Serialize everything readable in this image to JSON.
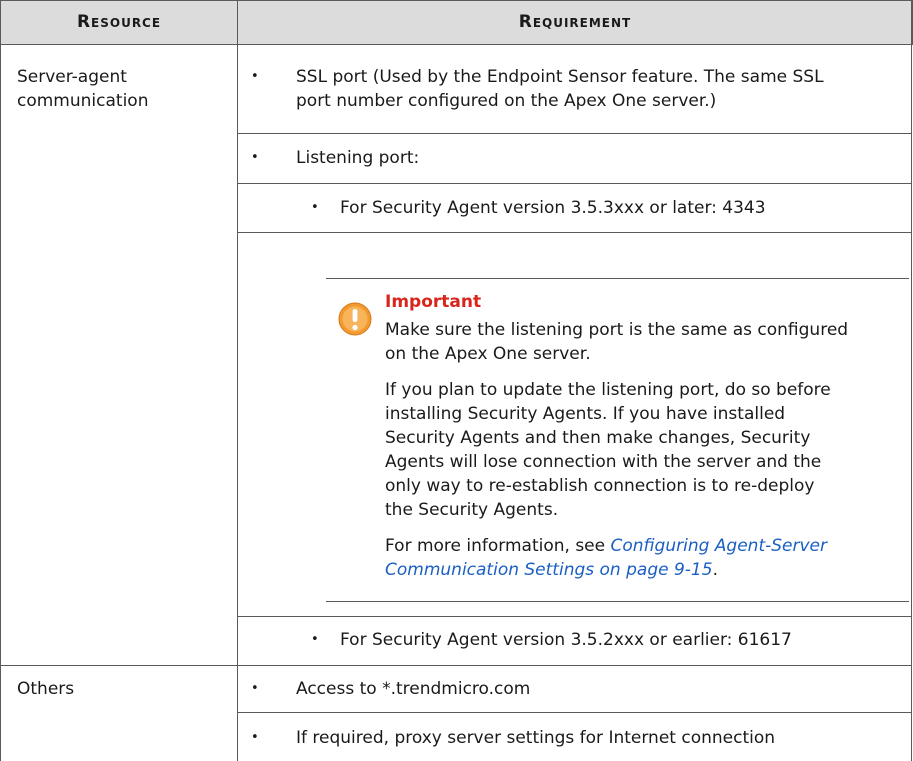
{
  "table": {
    "headers": {
      "resource": "Resource",
      "requirement": "Requirement"
    },
    "rows": [
      {
        "resource_line1": "Server-agent",
        "resource_line2": "communication",
        "items": {
          "ssl_line1": "SSL port (Used by the Endpoint Sensor feature. The same SSL",
          "ssl_line2": "port number configured on the Apex One server.)",
          "listening": "Listening port:",
          "sub_353": "For Security Agent version 3.5.3xxx or later: 4343",
          "sub_352": "For Security Agent version 3.5.2xxx or earlier: 61617"
        },
        "note": {
          "title": "Important",
          "p1_line1": "Make sure the listening port is the same as configured",
          "p1_line2": "on the Apex One server.",
          "p2_line1": "If you plan to update the listening port, do so before",
          "p2_line2": "installing Security Agents. If you have installed",
          "p2_line3": "Security Agents and then make changes, Security",
          "p2_line4": "Agents will lose connection with the server and the",
          "p2_line5": "only way to re-establish connection is to re-deploy",
          "p2_line6": "the Security Agents.",
          "p3_prefix": "For more information, see ",
          "p3_link_line1": "Configuring Agent-Server",
          "p3_link_line2": "Communication Settings on page 9-15",
          "p3_suffix": "."
        }
      },
      {
        "resource_line1": "Others",
        "items": {
          "access": "Access to *.trendmicro.com",
          "proxy": "If required, proxy server settings for Internet connection"
        }
      }
    ],
    "bullet_glyph": "•"
  },
  "colors": {
    "header_bg": "#dcdcdc",
    "rule": "#5a5a5a",
    "important_title": "#d9261c",
    "link": "#1a5fc4",
    "warn_icon": "#f29a2e"
  },
  "icons": {
    "note": "warning-icon"
  }
}
